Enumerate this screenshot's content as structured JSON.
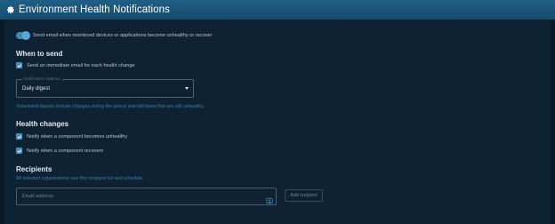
{
  "header": {
    "title": "Environment Health Notifications",
    "icon": "gear-icon"
  },
  "toggle": {
    "label": "Send email when monitored devices or applications become unhealthy or recover",
    "on": true
  },
  "when_to_send": {
    "title": "When to send",
    "immediate_label": "Send an immediate email for each health change",
    "immediate_checked": true,
    "schedule": {
      "legend": "Notification cadence",
      "value": "Daily digest"
    },
    "help": "Scheduled digests include changes during the period and still items that are still unhealthy."
  },
  "health_changes": {
    "title": "Health changes",
    "items": [
      {
        "label": "Notify when a component becomes unhealthy",
        "checked": true
      },
      {
        "label": "Notify when a component recovers",
        "checked": true
      }
    ]
  },
  "recipients": {
    "title": "Recipients",
    "subtitle": "All selected organizations use this recipient list and schedule.",
    "email_placeholder": "Email address",
    "add_label": "Add recipient"
  },
  "colors": {
    "header": "#1f5f86",
    "accent": "#4a8fbd",
    "panel": "#0f2233"
  }
}
